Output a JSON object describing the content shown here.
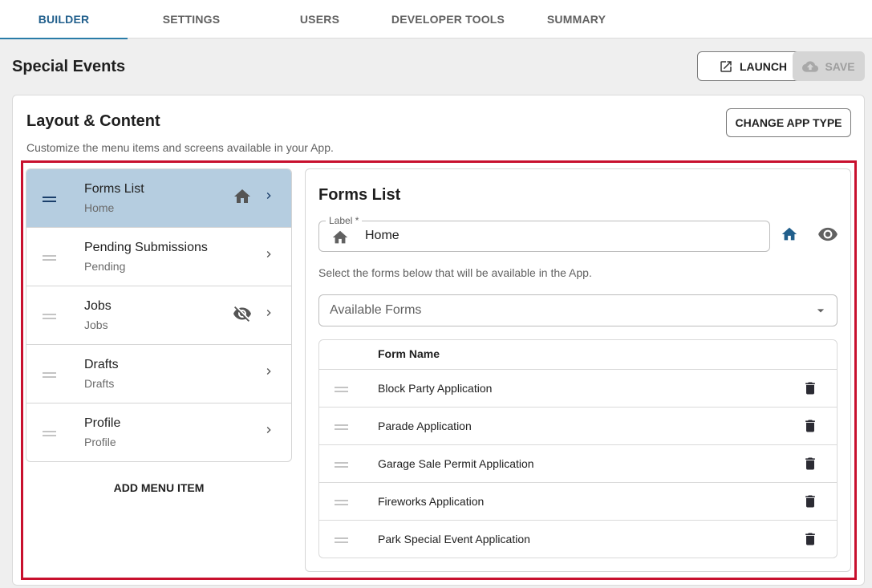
{
  "tabs": [
    {
      "label": "BUILDER",
      "active": true
    },
    {
      "label": "SETTINGS",
      "active": false
    },
    {
      "label": "USERS",
      "active": false
    },
    {
      "label": "DEVELOPER TOOLS",
      "active": false
    },
    {
      "label": "SUMMARY",
      "active": false
    }
  ],
  "header": {
    "title": "Special Events",
    "launch_label": "LAUNCH",
    "save_label": "SAVE"
  },
  "content": {
    "title": "Layout & Content",
    "subtitle": "Customize the menu items and screens available in your App.",
    "change_app_type_label": "CHANGE APP TYPE"
  },
  "menu": {
    "items": [
      {
        "title": "Forms List",
        "subtitle": "Home",
        "selected": true,
        "icon": "home-icon"
      },
      {
        "title": "Pending Submissions",
        "subtitle": "Pending",
        "selected": false,
        "icon": ""
      },
      {
        "title": "Jobs",
        "subtitle": "Jobs",
        "selected": false,
        "icon": "visibility-off-icon"
      },
      {
        "title": "Drafts",
        "subtitle": "Drafts",
        "selected": false,
        "icon": ""
      },
      {
        "title": "Profile",
        "subtitle": "Profile",
        "selected": false,
        "icon": ""
      }
    ],
    "add_label": "ADD MENU ITEM"
  },
  "detail": {
    "title": "Forms List",
    "label_legend": "Label *",
    "label_value": "Home",
    "forms_hint": "Select the forms below that will be available in the App.",
    "select_placeholder": "Available Forms",
    "table_header": "Form Name",
    "forms": [
      "Block Party Application",
      "Parade Application",
      "Garage Sale Permit Application",
      "Fireworks Application",
      "Park Special Event Application"
    ]
  },
  "colors": {
    "accent": "#215f8c",
    "selected_bg": "#b5cde0",
    "highlight_border": "#c8102e"
  }
}
